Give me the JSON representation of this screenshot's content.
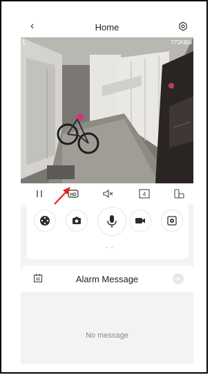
{
  "header": {
    "title": "Home",
    "back_icon": "chevron-left-icon",
    "settings_icon": "gear-icon"
  },
  "video": {
    "channel": "1",
    "bitrate": "772KB/s"
  },
  "controls": {
    "items": [
      "pause-icon",
      "hd-icon",
      "mute-icon",
      "split-4-icon",
      "device-rotate-icon"
    ],
    "split_label": "4",
    "hd_label": "HD"
  },
  "actions": {
    "items": [
      "ptz-icon",
      "snapshot-icon",
      "microphone-icon",
      "record-icon",
      "settings-camera-icon"
    ],
    "expand_icon": "double-chevron-down-icon"
  },
  "alarm": {
    "title": "Alarm Message",
    "empty_text": "No message"
  },
  "colors": {
    "accent_arrow": "#e0241b",
    "background": "#f3f3f5"
  }
}
